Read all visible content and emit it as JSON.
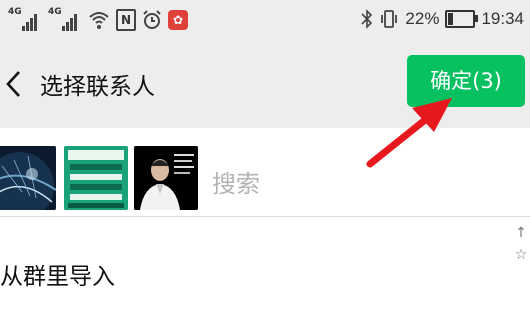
{
  "status_bar": {
    "network1": "4G",
    "network2": "4G",
    "battery": "22%",
    "battery_level": 0.22,
    "time": "19:34",
    "icons": [
      "signal-icon",
      "signal-icon",
      "wifi-icon",
      "nfc-icon",
      "alarm-icon",
      "app-notification-icon",
      "bluetooth-icon",
      "vibrate-icon",
      "battery-icon"
    ]
  },
  "header": {
    "title": "选择联系人",
    "confirm_label": "确定(3)",
    "back_icon": "back-chevron-icon"
  },
  "selected": {
    "avatars": [
      "avatar-earth-image",
      "avatar-green-poster-image",
      "avatar-man-portrait-image"
    ],
    "search_placeholder": "搜索"
  },
  "list": {
    "item_label": "从群里导入"
  },
  "index_bar": {
    "items": [
      "↑",
      "☆"
    ]
  },
  "colors": {
    "accent": "#07c160",
    "arrow": "#e8191e",
    "background": "#ededed"
  }
}
